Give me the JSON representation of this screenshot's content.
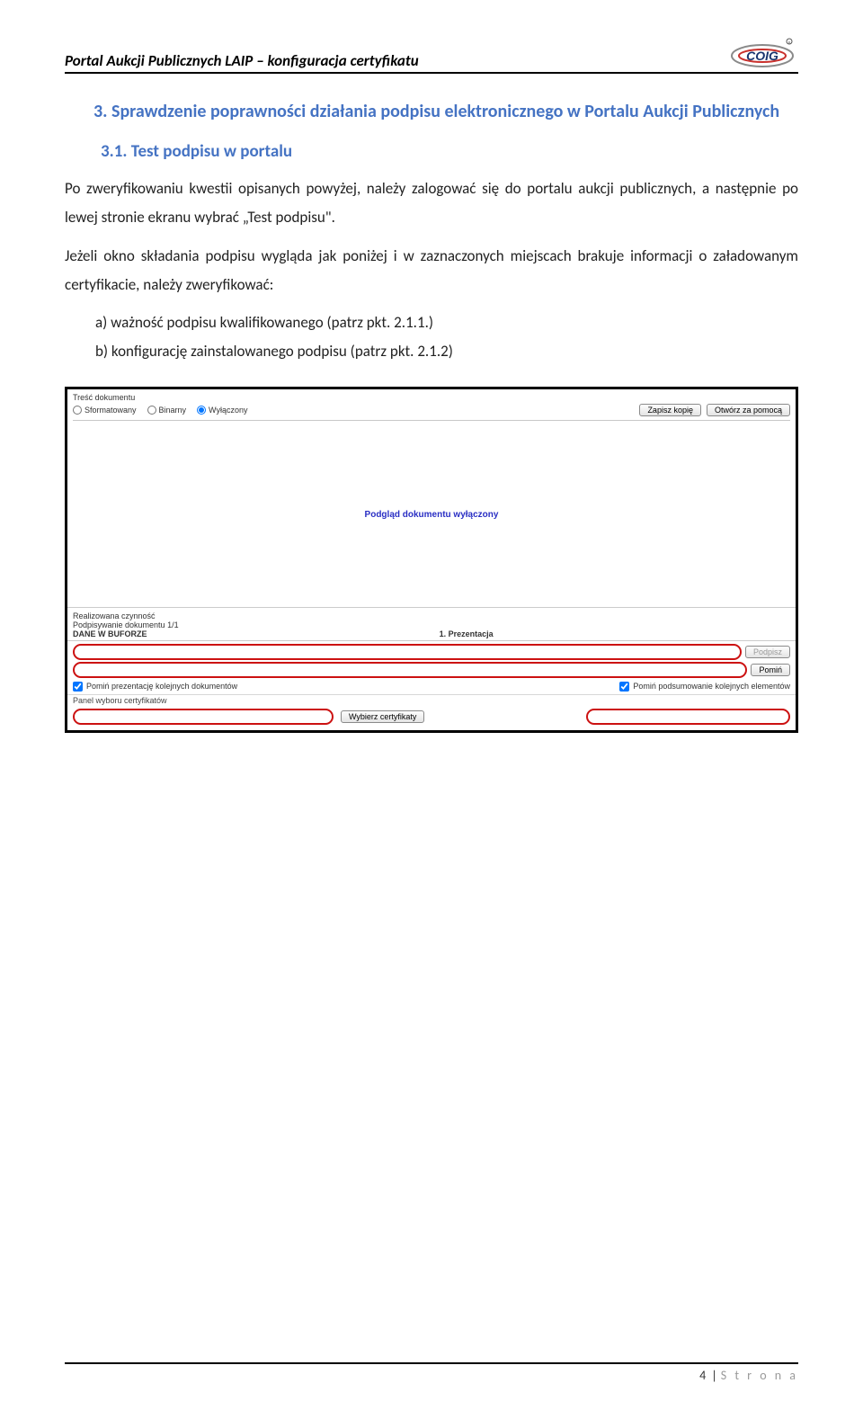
{
  "header": {
    "title": "Portal Aukcji Publicznych LAIP – konfiguracja certyfikatu",
    "logo_label": "COIG"
  },
  "section": {
    "num_title": "3. Sprawdzenie poprawności działania podpisu elektronicznego w Portalu Aukcji Publicznych",
    "sub_title": "3.1. Test podpisu w portalu",
    "p1": "Po zweryfikowaniu kwestii opisanych powyżej, należy zalogować się do portalu aukcji publicznych, a następnie po lewej stronie ekranu wybrać „Test podpisu\".",
    "p2": "Jeżeli okno składania podpisu wygląda jak poniżej i w zaznaczonych miejscach brakuje informacji o załadowanym certyfikacie, należy zweryfikować:",
    "li_a": "a)  ważność podpisu kwalifikowanego (patrz pkt. 2.1.1.)",
    "li_b": "b)  konfigurację zainstalowanego podpisu (patrz pkt. 2.1.2)"
  },
  "mock": {
    "tresc_label": "Treść dokumentu",
    "radio1": "Sformatowany",
    "radio2": "Binarny",
    "radio3": "Wyłączony",
    "btn_zapisz": "Zapisz kopię",
    "btn_otworz": "Otwórz za pomocą",
    "preview_text": "Podgląd dokumentu wyłączony",
    "czynnosc_label": "Realizowana czynność",
    "czynnosc_line2": "Podpisywanie dokumentu 1/1",
    "czynnosc_line3": "DANE W BUFORZE",
    "prezentacja": "1. Prezentacja",
    "btn_podpisz": "Podpisz",
    "btn_pomin": "Pomiń",
    "cb_left": "Pomiń prezentację kolejnych dokumentów",
    "cb_right": "Pomiń podsumowanie kolejnych elementów",
    "panel_label": "Panel wyboru certyfikatów",
    "btn_wybierz": "Wybierz certyfikaty"
  },
  "footer": {
    "page": "4",
    "label": "S t r o n a"
  }
}
